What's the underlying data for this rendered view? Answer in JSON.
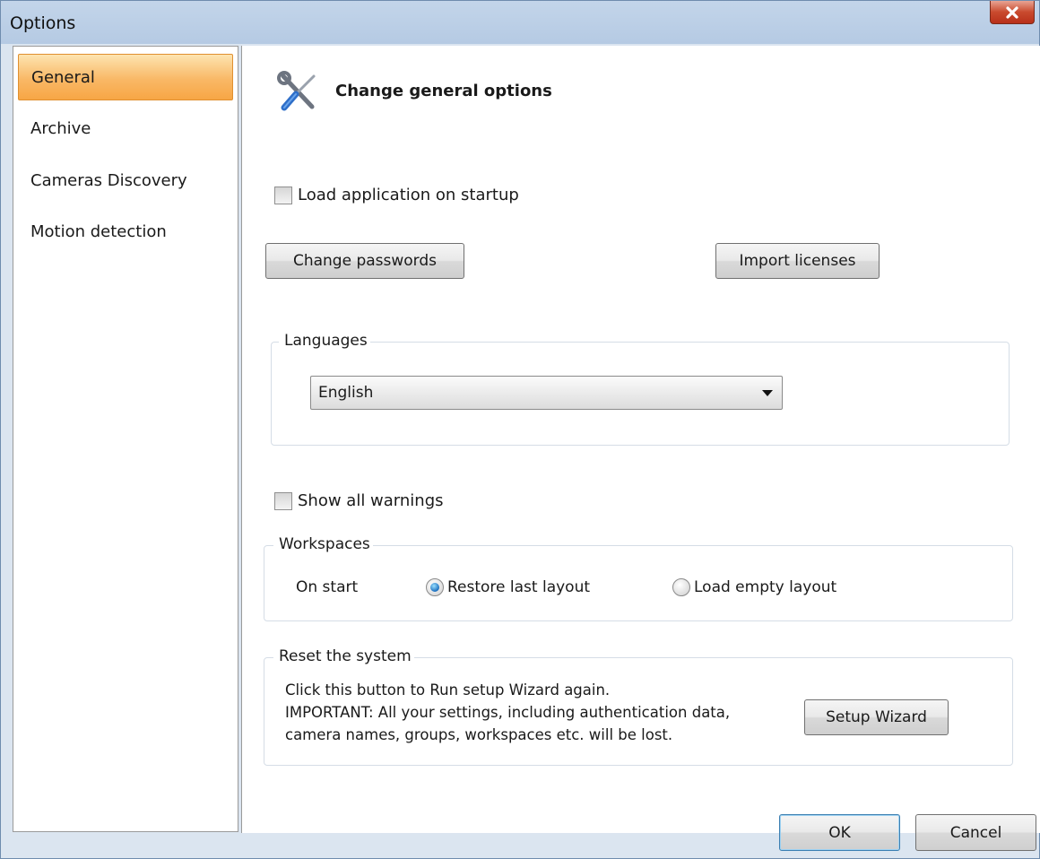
{
  "window": {
    "title": "Options"
  },
  "sidebar": {
    "items": [
      {
        "label": "General",
        "selected": true
      },
      {
        "label": "Archive",
        "selected": false
      },
      {
        "label": "Cameras Discovery",
        "selected": false
      },
      {
        "label": "Motion detection",
        "selected": false
      }
    ]
  },
  "header": {
    "title": "Change general options",
    "icon": "tools-icon"
  },
  "startup": {
    "label": "Load application on startup",
    "checked": false
  },
  "buttons": {
    "change_passwords": "Change passwords",
    "import_licenses": "Import licenses",
    "setup_wizard": "Setup Wizard",
    "ok": "OK",
    "cancel": "Cancel"
  },
  "languages": {
    "legend": "Languages",
    "selected": "English"
  },
  "warnings": {
    "label": "Show all warnings",
    "checked": false
  },
  "workspaces": {
    "legend": "Workspaces",
    "on_start_label": "On start",
    "options": [
      {
        "label": "Restore last layout",
        "checked": true
      },
      {
        "label": "Load empty layout",
        "checked": false
      }
    ]
  },
  "reset": {
    "legend": "Reset the system",
    "lines": [
      "Click this button to Run setup Wizard again.",
      "IMPORTANT: All your settings, including authentication data,",
      "camera names, groups, workspaces etc.  will be lost."
    ]
  },
  "colors": {
    "selected_nav": "#f9b866",
    "ok_border": "#3c7fb1",
    "window_bg": "#dbe5f0"
  }
}
